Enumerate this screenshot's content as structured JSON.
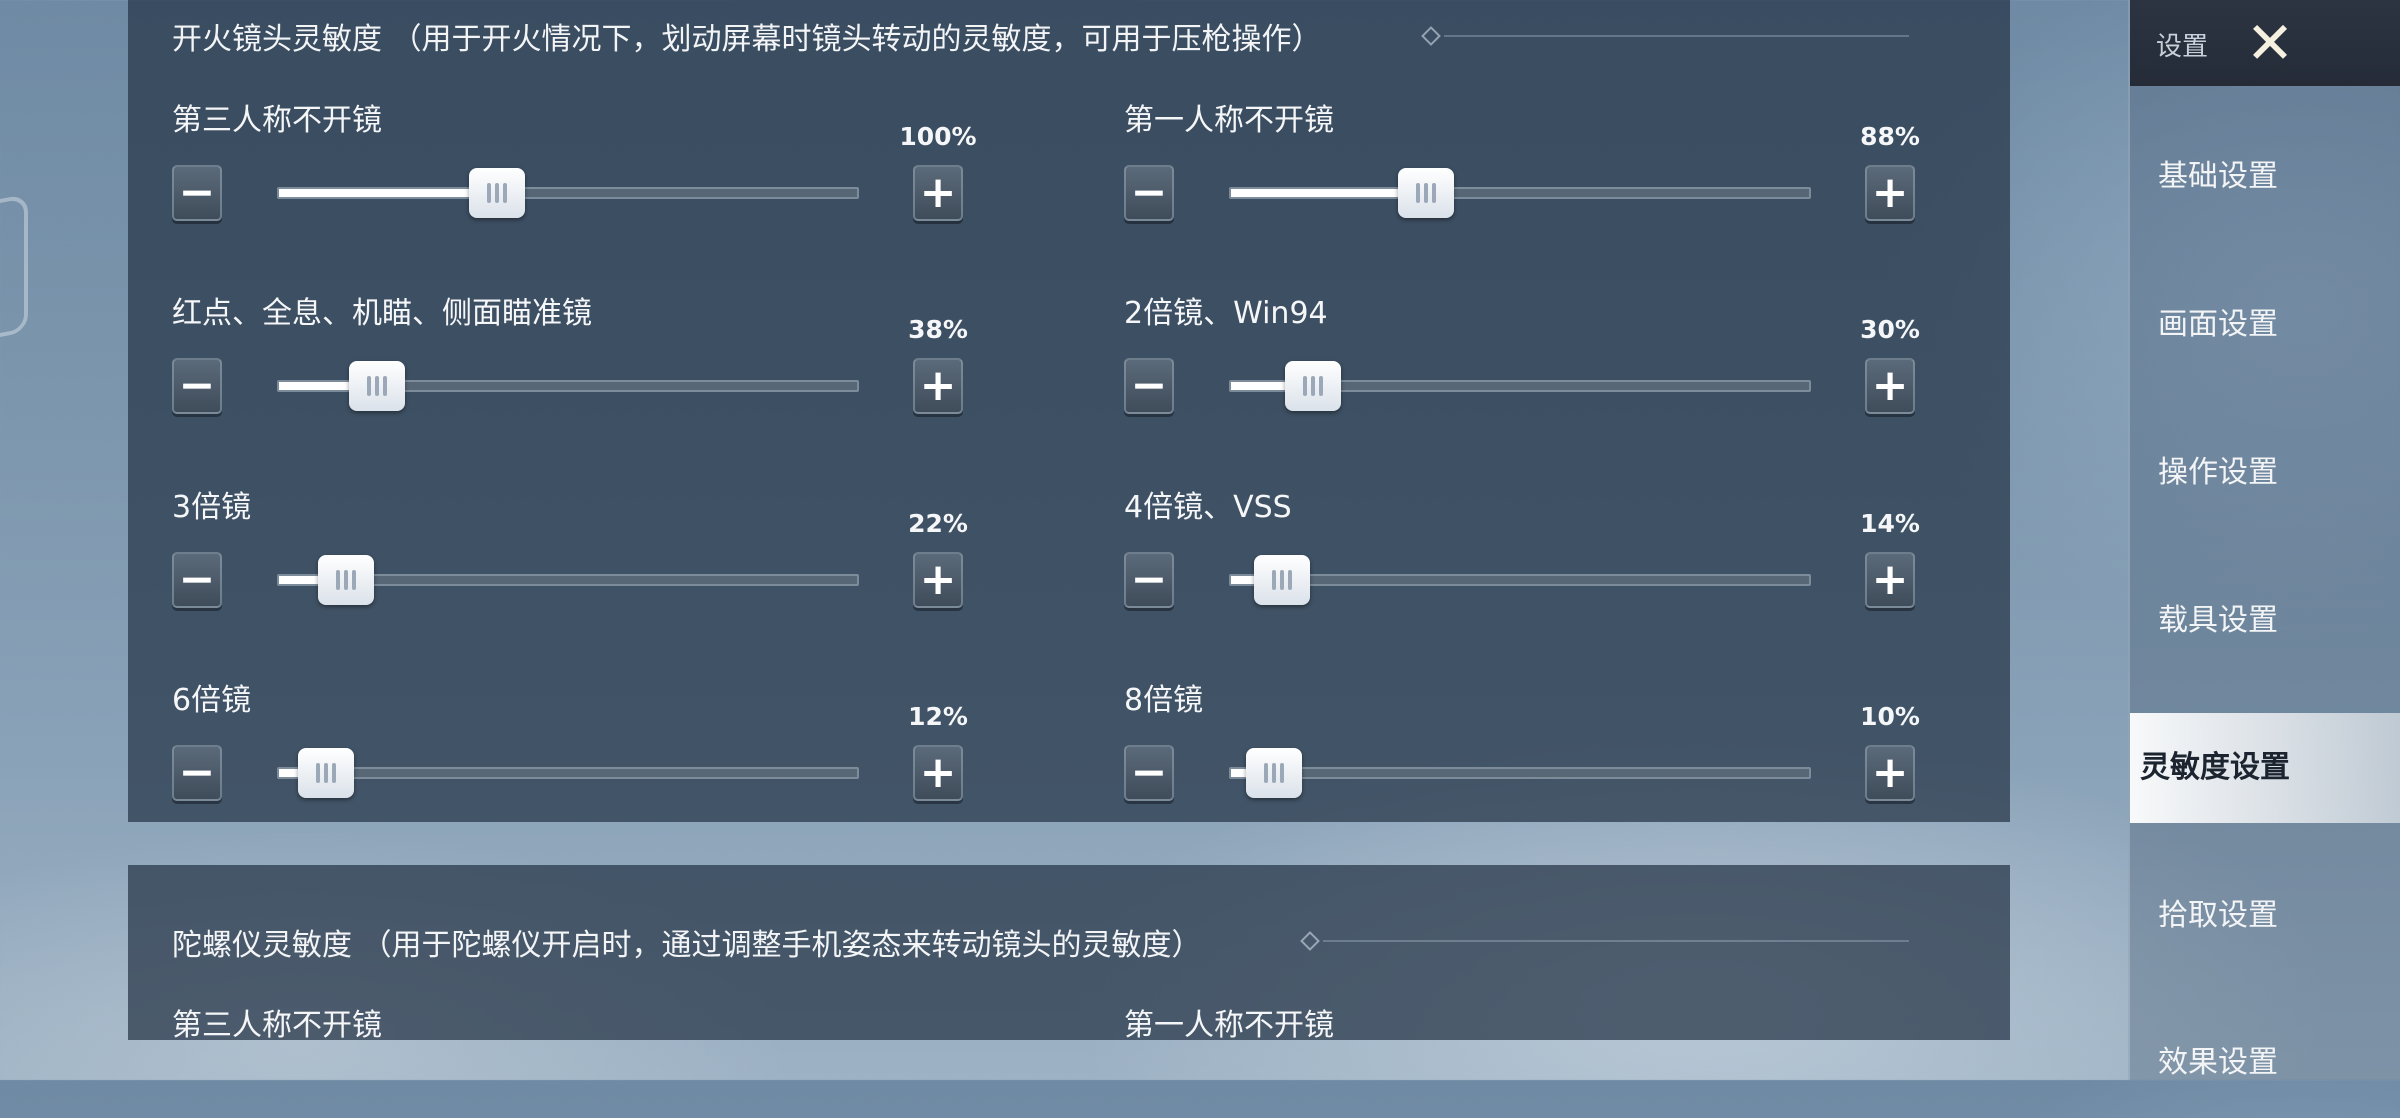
{
  "fire_section": {
    "title": "开火镜头灵敏度 （用于开火情况下，划动屏幕时镜头转动的灵敏度，可用于压枪操作）",
    "sliders": [
      {
        "label": "第三人称不开镜",
        "value": 100,
        "display": "100%"
      },
      {
        "label": "第一人称不开镜",
        "value": 88,
        "display": "88%"
      },
      {
        "label": "红点、全息、机瞄、侧面瞄准镜",
        "value": 38,
        "display": "38%"
      },
      {
        "label": "2倍镜、Win94",
        "value": 30,
        "display": "30%"
      },
      {
        "label": "3倍镜",
        "value": 22,
        "display": "22%"
      },
      {
        "label": "4倍镜、VSS",
        "value": 14,
        "display": "14%"
      },
      {
        "label": "6倍镜",
        "value": 12,
        "display": "12%"
      },
      {
        "label": "8倍镜",
        "value": 10,
        "display": "10%"
      }
    ]
  },
  "gyro_section": {
    "title": "陀螺仪灵敏度 （用于陀螺仪开启时，通过调整手机姿态来转动镜头的灵敏度）",
    "labels": [
      "第三人称不开镜",
      "第一人称不开镜"
    ]
  },
  "controls": {
    "minus": "−",
    "plus": "+"
  },
  "sidebar": {
    "title": "设置",
    "close": "✕",
    "items": [
      {
        "label": "基础设置",
        "active": false
      },
      {
        "label": "画面设置",
        "active": false
      },
      {
        "label": "操作设置",
        "active": false
      },
      {
        "label": "载具设置",
        "active": false
      },
      {
        "label": "灵敏度设置",
        "active": true
      },
      {
        "label": "拾取设置",
        "active": false
      },
      {
        "label": "效果设置",
        "active": false
      }
    ]
  }
}
